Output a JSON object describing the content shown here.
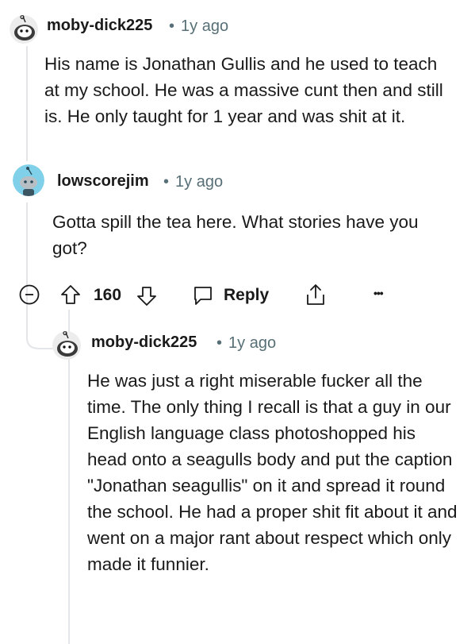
{
  "comments": [
    {
      "username": "moby-dick225",
      "time": "1y ago",
      "separator": "•",
      "body": "His name is Jonathan Gullis and he used to teach at my school. He was a massive cunt then and still is. He only taught for 1 year and was shit at it."
    },
    {
      "username": "lowscorejim",
      "time": "1y ago",
      "separator": "•",
      "body": "Gotta spill the tea here. What stories have you got?",
      "votes": "160",
      "reply_label": "Reply",
      "more_label": "•••"
    },
    {
      "username": "moby-dick225",
      "time": "1y ago",
      "separator": "•",
      "body": "He was just a right miserable fucker all the time. The only thing I recall is that a guy in our English language class photoshopped his head onto a seagulls body and put the caption \"Jonathan seagullis\" on it and spread it round the school. He had a proper shit fit about it and went on a major rant about respect which only made it funnier."
    }
  ],
  "icons": {
    "avatar1": "snoo-avatar-icon",
    "avatar2": "snoo-avatar-icon",
    "avatar3": "snoo-avatar-icon",
    "collapse": "minus-circle-icon",
    "upvote": "arrow-up-icon",
    "downvote": "arrow-down-icon",
    "reply": "chat-bubble-icon",
    "share": "share-icon",
    "more": "ellipsis-icon"
  },
  "colors": {
    "text": "#1a1a1b",
    "meta": "#576f76",
    "thread_line": "#e3e5e8",
    "avatar2_bg": "#7fd0e8"
  }
}
